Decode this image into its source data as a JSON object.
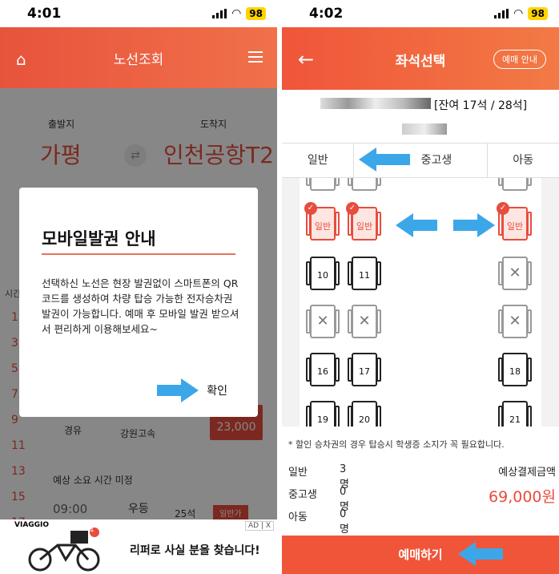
{
  "left": {
    "status": {
      "time": "4:01",
      "battery": "98"
    },
    "header": {
      "title": "노선조회"
    },
    "route": {
      "depart_label": "출발지",
      "arrive_label": "도착지",
      "depart_city": "가평",
      "arrive_city": "인천공항T2"
    },
    "background": {
      "time_col_label": "시간",
      "hours": [
        "1",
        "3",
        "5",
        "7",
        "9",
        "11",
        "13",
        "15",
        "17"
      ],
      "row1_via": "경유",
      "row1_company": "강원고속",
      "row1_price": "23,000",
      "row2_note": "예상 소요 시간 미정",
      "row2_time": "09:00",
      "row2_grade": "우등",
      "row2_seats": "25석",
      "row2_btn": "일반가"
    },
    "modal": {
      "title": "모바일발권 안내",
      "body": "선택하신 노선은 현장 발권없이 스마트폰의 QR코드를 생성하여 차량 탑승 가능한 전자승차권 발권이 가능합니다. 예매 후 모바일 발권 받으셔서 편리하게 이용해보세요~",
      "ok": "확인"
    },
    "ad": {
      "brand": "VIAGGIO",
      "text": "리퍼로 사실 분을 찾습니다!",
      "badge": "AD | X",
      "notif": "1"
    }
  },
  "right": {
    "status": {
      "time": "4:02",
      "battery": "98"
    },
    "header": {
      "title": "좌석선택",
      "guide": "예매 안내"
    },
    "remaining": "[잔여 17석 / 28석]",
    "tabs": [
      "일반",
      "중고생",
      "아동"
    ],
    "seats": {
      "general": "일반",
      "numbers": [
        "10",
        "11",
        "16",
        "17",
        "18",
        "19",
        "20",
        "21"
      ]
    },
    "notice": "* 할인 승차권의 경우 탑승시 학생증 소지가 꼭 필요합니다.",
    "counts": [
      {
        "label": "일반",
        "value": "3명"
      },
      {
        "label": "중고생",
        "value": "0명"
      },
      {
        "label": "아동",
        "value": "0명"
      }
    ],
    "pay_label": "예상결제금액",
    "pay_amount": "69,000원",
    "book": "예매하기"
  },
  "colors": {
    "accent": "#e84c3d",
    "arrow": "#3ca7e8"
  }
}
